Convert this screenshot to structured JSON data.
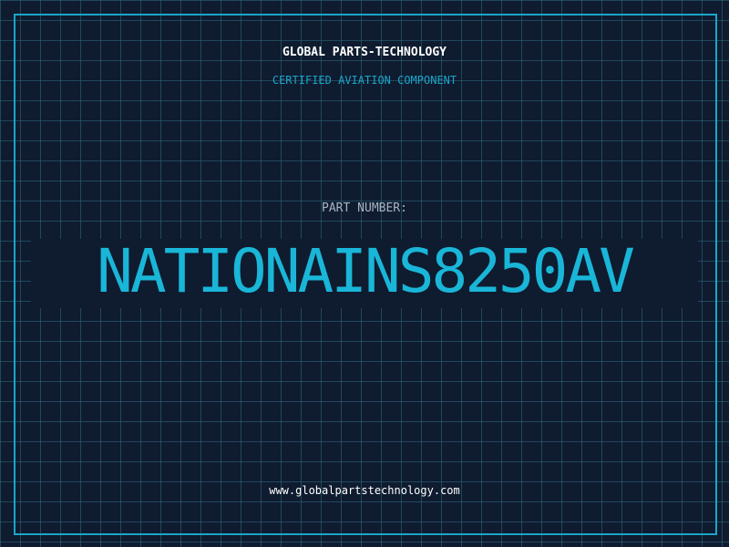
{
  "header": {
    "company": "GLOBAL PARTS-TECHNOLOGY",
    "tagline": "CERTIFIED AVIATION COMPONENT"
  },
  "part": {
    "label": "PART NUMBER:",
    "number": "NATIONAINS8250AV"
  },
  "footer": {
    "url": "www.globalpartstechnology.com"
  },
  "colors": {
    "background": "#0f1b2f",
    "grid": "#2d6e82",
    "accent": "#1aa6c8",
    "part_number": "#19b6d8",
    "title": "#ffffff",
    "label": "#a9b4c2"
  }
}
